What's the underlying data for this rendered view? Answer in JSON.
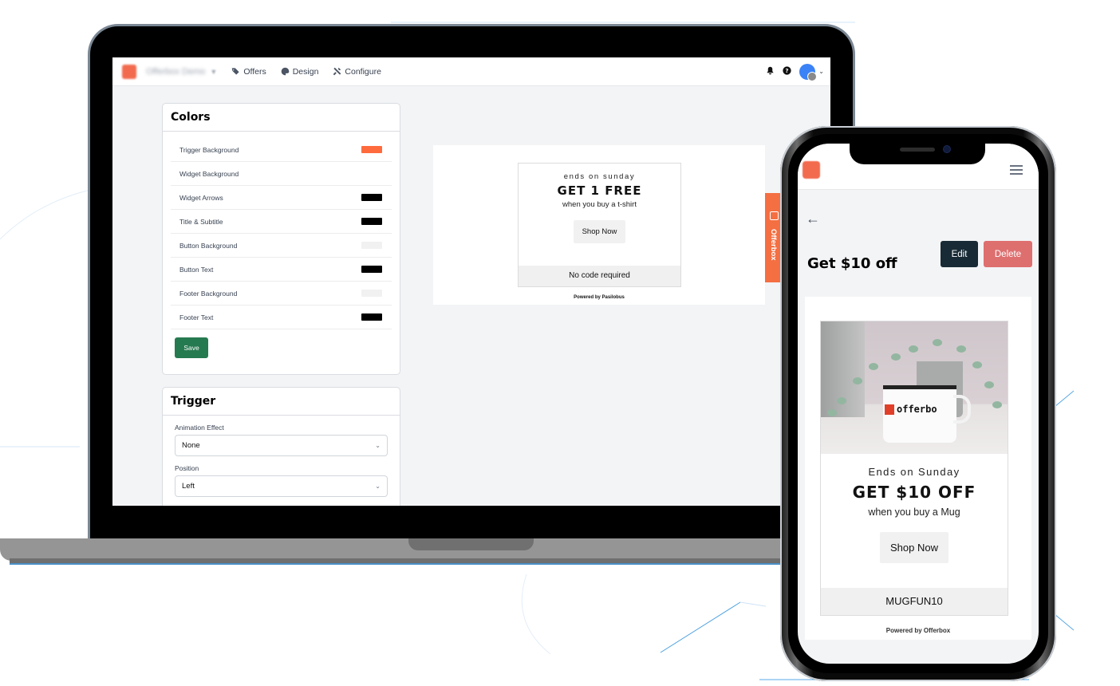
{
  "laptop": {
    "navbar": {
      "brand_name": "Offerbox Demo",
      "nav_items": [
        {
          "label": "Offers",
          "icon": "tags-icon"
        },
        {
          "label": "Design",
          "icon": "palette-icon"
        },
        {
          "label": "Configure",
          "icon": "tools-icon"
        }
      ],
      "right_icons": [
        "bell-icon",
        "help-icon",
        "avatar"
      ]
    },
    "colors_card": {
      "title": "Colors",
      "rows": [
        {
          "label": "Trigger Background",
          "color": "#ff6b3d"
        },
        {
          "label": "Widget Background",
          "color": "#ffffff"
        },
        {
          "label": "Widget Arrows",
          "color": "#000000"
        },
        {
          "label": "Title & Subtitle",
          "color": "#000000"
        },
        {
          "label": "Button Background",
          "color": "#f1f1f1"
        },
        {
          "label": "Button Text",
          "color": "#000000"
        },
        {
          "label": "Footer Background",
          "color": "#f1f1f1"
        },
        {
          "label": "Footer Text",
          "color": "#000000"
        }
      ],
      "save_label": "Save"
    },
    "trigger_card": {
      "title": "Trigger",
      "animation_label": "Animation Effect",
      "animation_value": "None",
      "position_label": "Position",
      "position_value": "Left"
    },
    "preview": {
      "subtitle": "ends on sunday",
      "title": "GET 1 FREE",
      "description": "when you buy a t-shirt",
      "button_label": "Shop Now",
      "footer_text": "No code required",
      "powered_by": "Powered by Pasilobus",
      "side_tab_label": "Offerbox"
    }
  },
  "phone": {
    "page_title": "Get $10 off",
    "edit_label": "Edit",
    "delete_label": "Delete",
    "widget": {
      "image_alt": "Mug with offerbox logo next to a plant",
      "mug_text": "offerbo",
      "subtitle": "Ends on Sunday",
      "title": "GET $10 OFF",
      "description": "when you buy a Mug",
      "button_label": "Shop Now",
      "coupon_code": "MUGFUN10"
    },
    "powered_by": "Powered by Offerbox"
  }
}
